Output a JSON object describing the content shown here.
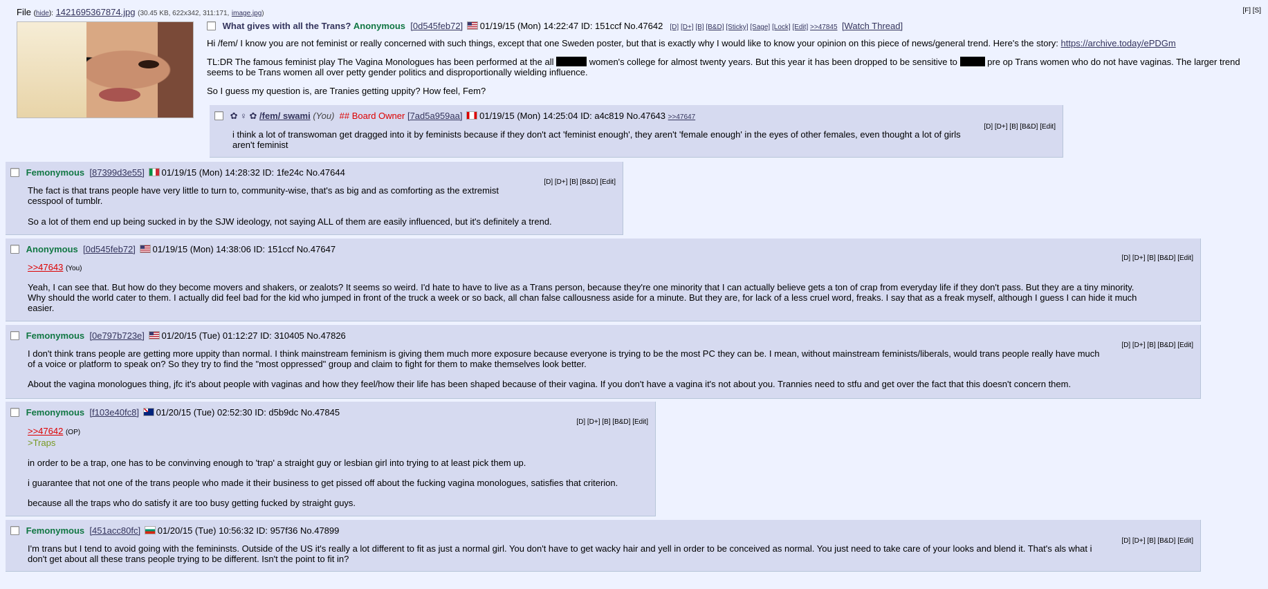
{
  "file_bar": {
    "label": "File",
    "hide": "hide",
    "filename": "1421695367874.jpg",
    "meta": "(30.45 KB, 622x342, 311:171,",
    "image_link": "image.jpg",
    "meta_close": ")"
  },
  "corner_links": "[F] [S]",
  "op": {
    "subject": "What gives with all the Trans?",
    "name": "Anonymous",
    "hash": "[0d545feb72]",
    "flag": "us",
    "datetime": "01/19/15 (Mon) 14:22:47",
    "id": "ID: 151ccf",
    "no": "No.47642",
    "mod_links": [
      "[D]",
      "[D+]",
      "[B]",
      "[B&D]",
      "[Sticky]",
      "[Sage]",
      "[Lock]",
      "[Edit]"
    ],
    "backlink": ">>47845",
    "watch": "[Watch Thread]",
    "p1": "Hi /fem/ I know you are not feminist or really concerned with such things, except that one Sweden poster, but that is exactly why I would like to know your opinion on this piece of news/general trend. Here's the story:",
    "p1_link": "https://archive.today/ePDGm",
    "p2a": "TL:DR The famous feminist play The Vagina Monologues has been performed at the all",
    "p2b": "women's college for almost twenty years. But this year it has been dropped to be sensitive to",
    "p2c": "pre op Trans women who do not have vaginas. The larger trend",
    "p2d": "seems to be Trans women all over petty gender politics and disproportionally wielding influence.",
    "p3": "So I guess my question is, are Tranies getting uppity? How feel, Fem?"
  },
  "replies": [
    {
      "name": "/fem/ swami",
      "you": "(You)",
      "capcode": "## Board Owner",
      "hash": "[7ad5a959aa]",
      "flag": "ca",
      "datetime": "01/19/15 (Mon) 14:25:04",
      "id": "ID: a4c819",
      "no": "No.47643",
      "backlink": ">>47647",
      "tools": "[D] [D+] [B] [B&D] [Edit]",
      "p1": "i think a lot of transwoman get dragged into it by feminists because if they don't act 'feminist enough', they aren't 'female enough' in the eyes of other females, even thought a lot of girls",
      "p2": "aren't feminist"
    },
    {
      "name": "Femonymous",
      "hash": "[87399d3e55]",
      "flag": "it",
      "datetime": "01/19/15 (Mon) 14:28:32",
      "id": "ID: 1fe24c",
      "no": "No.47644",
      "tools": "[D] [D+] [B] [B&D] [Edit]",
      "p1": "The fact is that trans people have very little to turn to, community-wise, that's as big and as comforting as the extremist",
      "p1b": "cesspool of tumblr.",
      "p2": "So a lot of them end up being sucked in by the SJW ideology, not saying ALL of them are easily influenced, but it's definitely a trend."
    },
    {
      "name": "Anonymous",
      "hash": "[0d545feb72]",
      "flag": "us",
      "datetime": "01/19/15 (Mon) 14:38:06",
      "id": "ID: 151ccf",
      "no": "No.47647",
      "tools": "[D] [D+] [B] [B&D] [Edit]",
      "quote": ">>47643",
      "quote_note": "(You)",
      "l1": "Yeah, I can see that. But how do they become movers and shakers, or zealots? It seems so weird. I'd hate to have to live as a Trans person, because they're one minority that I can actually believe gets a ton of crap from everyday life if they don't pass. But they are a tiny minority.",
      "l2": "Why should the world cater to them. I actually did feel bad for the kid who jumped in front of the truck a week or so back, all chan false callousness aside for a minute. But they are, for lack of a less cruel word, freaks. I say that as a freak myself, although I guess I can hide it much",
      "l3": "easier."
    },
    {
      "name": "Femonymous",
      "hash": "[0e797b723e]",
      "flag": "us",
      "datetime": "01/20/15 (Tue) 01:12:27",
      "id": "ID: 310405",
      "no": "No.47826",
      "tools": "[D] [D+] [B] [B&D] [Edit]",
      "l1": "I don't think trans people are getting more uppity than normal. I think mainstream feminism is giving them much more exposure because everyone is trying to be the most PC they can be. I mean, without mainstream feminists/liberals, would trans people really have much",
      "l2": "of a voice or platform to speak on? So they try to find the \"most oppressed\" group and claim to fight for them to make themselves look better.",
      "l3": "About the vagina monologues thing, jfc it's about people with vaginas and how they feel/how their life has been shaped because of their vagina. If you don't have a vagina it's not about you. Trannies need to stfu and get over the fact that this doesn't concern them."
    },
    {
      "name": "Femonymous",
      "hash": "[f103e40fc8]",
      "flag": "au",
      "datetime": "01/20/15 (Tue) 02:52:30",
      "id": "ID: d5b9dc",
      "no": "No.47845",
      "tools": "[D] [D+] [B] [B&D] [Edit]",
      "quote": ">>47642",
      "quote_note": "(OP)",
      "green": ">Traps",
      "l1": "in order to be a trap, one has to be convinving enough to 'trap' a straight guy or lesbian girl into trying to at least pick them up.",
      "l2": "i guarantee that not one of the trans people who made it their business to get pissed off about the fucking vagina monologues, satisfies that criterion.",
      "l3": "because all the traps who do satisfy it are too busy getting fucked by straight guys."
    },
    {
      "name": "Femonymous",
      "hash": "[451acc80fc]",
      "flag": "bg",
      "datetime": "01/20/15 (Tue) 10:56:32",
      "id": "ID: 957f36",
      "no": "No.47899",
      "tools": "[D] [D+] [B] [B&D] [Edit]",
      "l1": "I'm trans but I tend to avoid going with the femininsts. Outside of the US it's really a lot different to fit as just a normal girl. You don't have to get wacky hair and yell in order to be conceived as normal. You just need to take care of your looks and blend it. That's als what i",
      "l2": "don't get about all these trans people trying to be different. Isn't the point to fit in?"
    }
  ]
}
